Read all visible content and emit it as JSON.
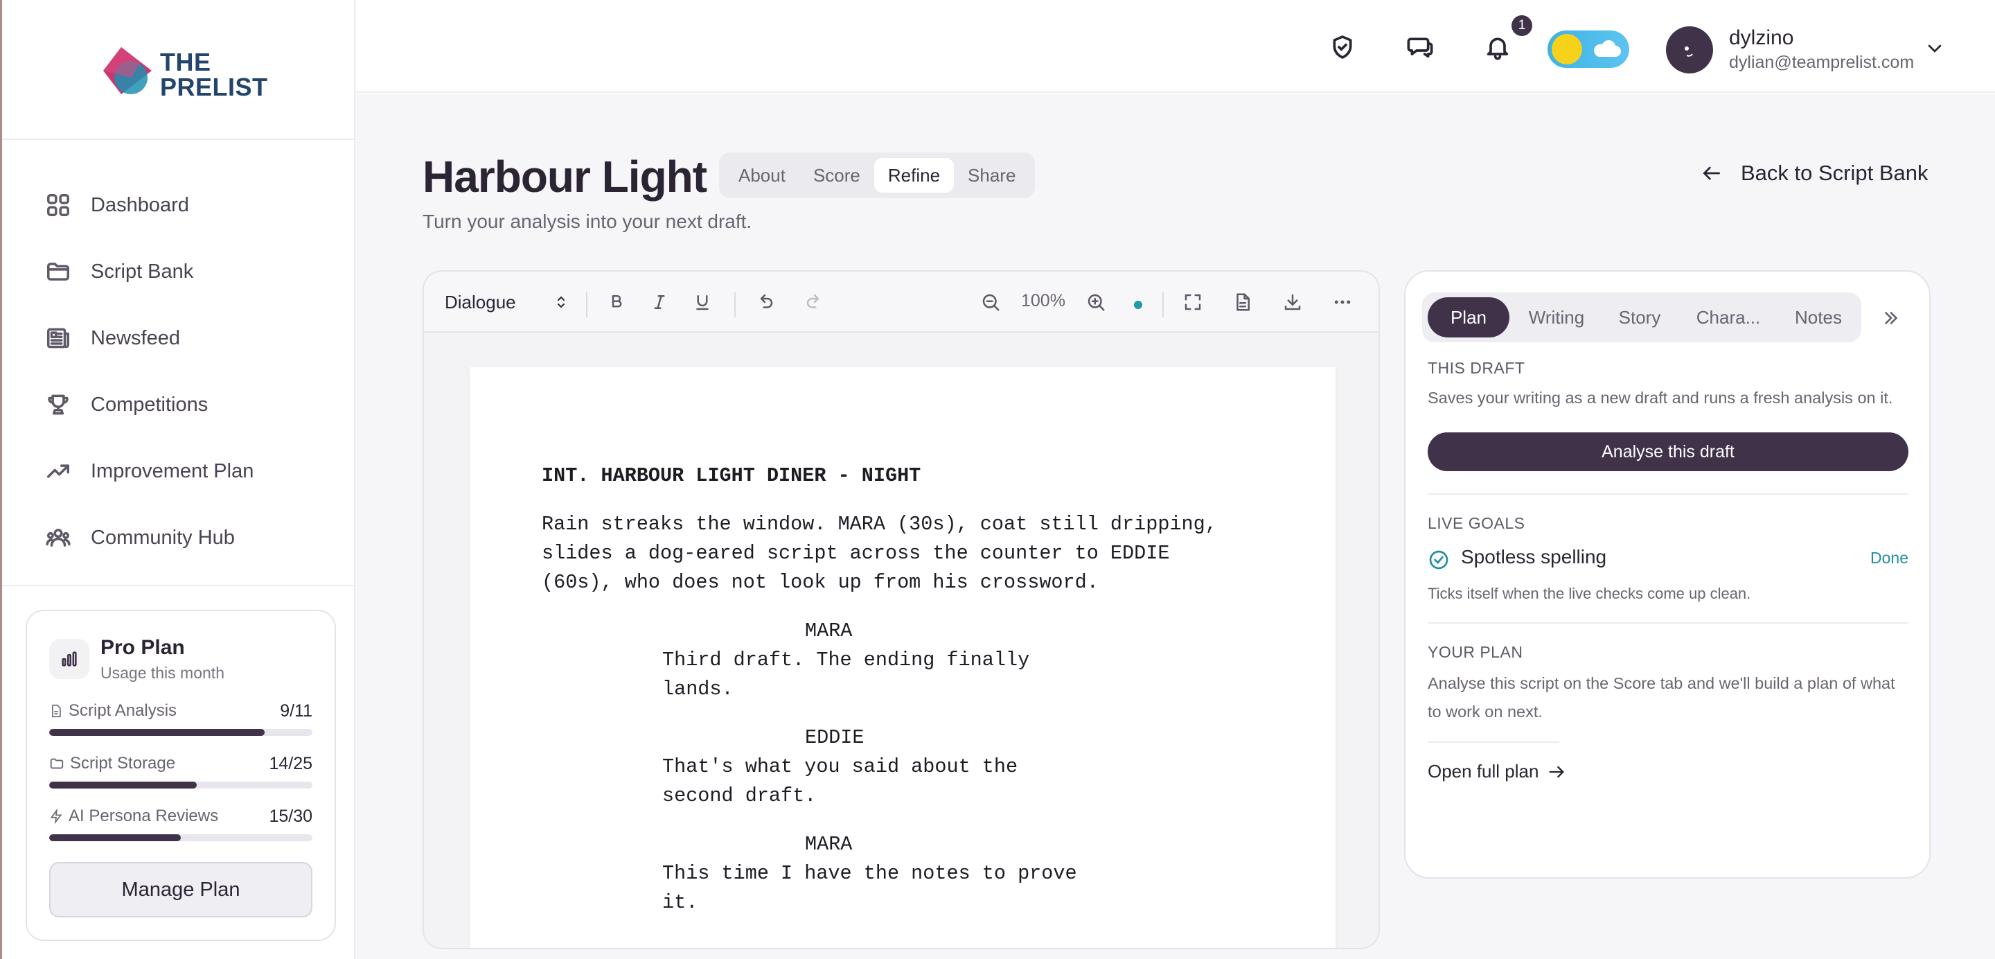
{
  "brand": {
    "logo_line1": "THE",
    "logo_line2": "PRELIST"
  },
  "sidebar": {
    "items": [
      {
        "label": "Dashboard",
        "icon": "grid-icon"
      },
      {
        "label": "Script Bank",
        "icon": "folder-icon"
      },
      {
        "label": "Newsfeed",
        "icon": "newspaper-icon"
      },
      {
        "label": "Competitions",
        "icon": "trophy-icon"
      },
      {
        "label": "Improvement Plan",
        "icon": "trending-up-icon"
      },
      {
        "label": "Community Hub",
        "icon": "users-icon"
      }
    ],
    "plan": {
      "title": "Pro Plan",
      "subtitle": "Usage this month",
      "usage": [
        {
          "label": "Script Analysis",
          "value": "9/11",
          "fraction": 0.818
        },
        {
          "label": "Script Storage",
          "value": "14/25",
          "fraction": 0.56
        },
        {
          "label": "AI Persona Reviews",
          "value": "15/30",
          "fraction": 0.5
        }
      ],
      "manage_label": "Manage Plan"
    }
  },
  "header": {
    "notification_count": "1",
    "user": {
      "name": "dylzino",
      "email": "dylian@teamprelist.com"
    }
  },
  "page": {
    "title": "Harbour Light",
    "subtitle": "Turn your analysis into your next draft.",
    "tabs": [
      "About",
      "Score",
      "Refine",
      "Share"
    ],
    "active_tab": "Refine",
    "back_label": "Back to Script Bank"
  },
  "editor": {
    "element_type": "Dialogue",
    "zoom": "100%",
    "script": {
      "slugline": "INT. HARBOUR LIGHT DINER - NIGHT",
      "action": [
        "Rain streaks the window. MARA (30s), coat still dripping,",
        "slides a dog-eared script across the counter to EDDIE",
        "(60s), who does not look up from his crossword."
      ],
      "dialogue": [
        {
          "character": "MARA",
          "lines": [
            "Third draft. The ending finally",
            "lands."
          ]
        },
        {
          "character": "EDDIE",
          "lines": [
            "That's what you said about the",
            "second draft."
          ]
        },
        {
          "character": "MARA",
          "lines": [
            "This time I have the notes to prove",
            "it."
          ]
        }
      ]
    }
  },
  "panel": {
    "tabs": [
      "Plan",
      "Writing",
      "Story",
      "Chara...",
      "Notes"
    ],
    "active_tab": "Plan",
    "this_draft": {
      "heading": "THIS DRAFT",
      "text": "Saves your writing as a new draft and runs a fresh analysis on it.",
      "button": "Analyse this draft"
    },
    "live_goals": {
      "heading": "LIVE GOALS",
      "goal_name": "Spotless spelling",
      "goal_status": "Done",
      "goal_text": "Ticks itself when the live checks come up clean."
    },
    "your_plan": {
      "heading": "YOUR PLAN",
      "text": "Analyse this script on the Score tab and we'll build a plan of what to work on next.",
      "link": "Open full plan"
    }
  },
  "colors": {
    "accent": "#3f3249",
    "link_teal": "#1e8ea0",
    "logo_navy": "#23446b",
    "logo_pink": "#c9376f"
  }
}
